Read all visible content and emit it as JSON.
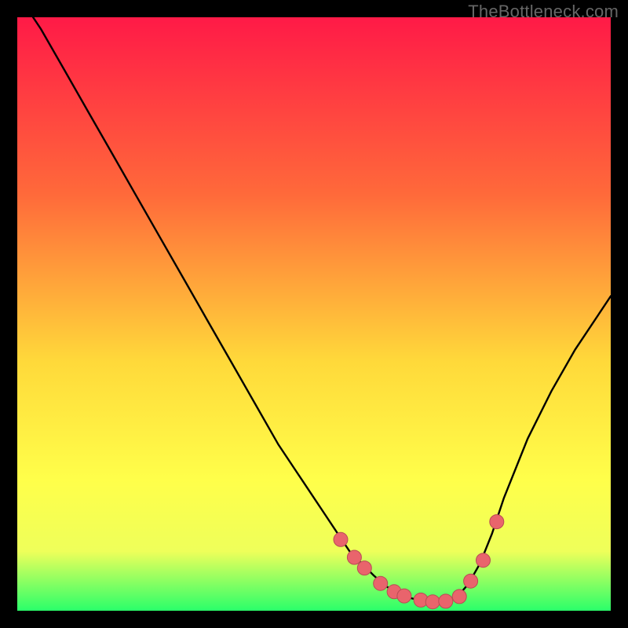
{
  "watermark": "TheBottleneck.com",
  "colors": {
    "frame": "#000000",
    "grad_top": "#ff1a47",
    "grad_mid1": "#ff6a3a",
    "grad_mid2": "#ffd93a",
    "grad_mid3": "#ffff4a",
    "grad_mid4": "#eeff5a",
    "grad_bottom": "#2aff6a",
    "curve": "#000000",
    "dot_fill": "#e9646c",
    "dot_stroke": "#b84c54"
  },
  "chart_data": {
    "type": "line",
    "title": "",
    "xlabel": "",
    "ylabel": "",
    "xlim": [
      0,
      100
    ],
    "ylim": [
      0,
      100
    ],
    "series": [
      {
        "name": "bottleneck-curve",
        "x": [
          0,
          4,
          8,
          12,
          16,
          20,
          24,
          28,
          32,
          36,
          40,
          44,
          48,
          52,
          54,
          56,
          58,
          60,
          62,
          64,
          66,
          68,
          70,
          72,
          74,
          76,
          78,
          80,
          82,
          86,
          90,
          94,
          98,
          100
        ],
        "y": [
          104,
          98,
          91,
          84,
          77,
          70,
          63,
          56,
          49,
          42,
          35,
          28,
          22,
          16,
          13,
          10,
          8,
          6,
          4.2,
          3,
          2.2,
          1.7,
          1.4,
          1.5,
          2.2,
          4.5,
          8,
          13,
          19,
          29,
          37,
          44,
          50,
          53
        ]
      }
    ],
    "points": {
      "name": "highlight-dots",
      "x": [
        54.5,
        56.8,
        58.5,
        61.2,
        63.5,
        65.2,
        68.0,
        70.0,
        72.2,
        74.5,
        76.4,
        78.5,
        80.8
      ],
      "y": [
        12.0,
        9.0,
        7.2,
        4.6,
        3.2,
        2.5,
        1.8,
        1.5,
        1.6,
        2.4,
        5.0,
        8.5,
        15.0
      ]
    }
  }
}
